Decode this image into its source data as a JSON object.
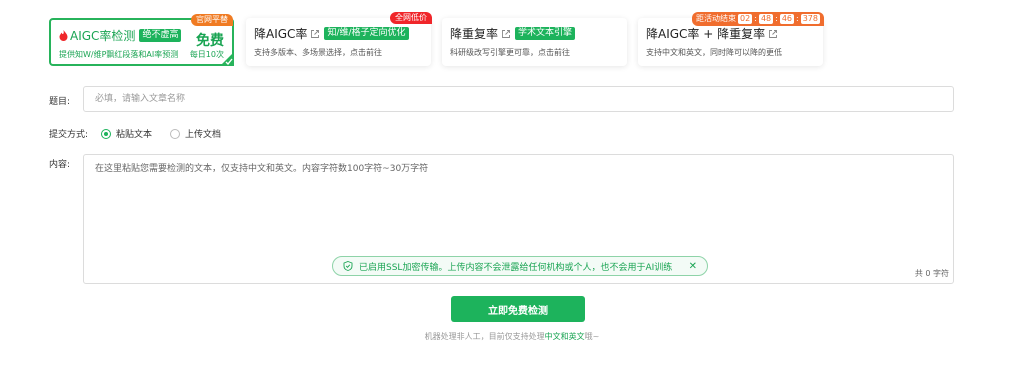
{
  "cards": [
    {
      "title": "AIGC率检测",
      "tag": "绝不虚高",
      "desc": "提供知W/维P飘红段落和AI率预测",
      "ribbon": "官网平替",
      "free": "免费",
      "daily": "每日10次"
    },
    {
      "title": "降AIGC率",
      "tag": "知/维/格子定向优化",
      "desc": "支持多版本、多场景选择，点击前往",
      "ribbon": "全网低价"
    },
    {
      "title": "降重复率",
      "tag": "学术文本引擎",
      "desc": "科研级改写引擎更可靠，点击前往"
    },
    {
      "title": "降AIGC率 + 降重复率",
      "desc": "支持中文和英文，同时降可以降的更低",
      "ribbon": "距活动结束",
      "timer": [
        "02",
        "48",
        "46",
        "378"
      ]
    }
  ],
  "form": {
    "title_label": "题目:",
    "title_placeholder": "必填，请输入文章名称",
    "method_label": "提交方式:",
    "method_options": [
      "粘贴文本",
      "上传文档"
    ],
    "content_label": "内容:",
    "content_placeholder": "在这里粘贴您需要检测的文本，仅支持中文和英文。内容字符数100字符~30万字符",
    "ssl_notice": "已启用SSL加密传输。上传内容不会泄露给任何机构或个人，也不会用于AI训练",
    "char_count": "共 0 字符"
  },
  "submit_label": "立即免费检测",
  "footer": {
    "prefix": "机器处理非人工，目前仅支持处理",
    "highlight": "中文和英文",
    "suffix": "哦~"
  },
  "colors": {
    "accent": "#1db35c",
    "ribbon_red": "#f0262a",
    "ribbon_orange": "#f06d2e"
  }
}
